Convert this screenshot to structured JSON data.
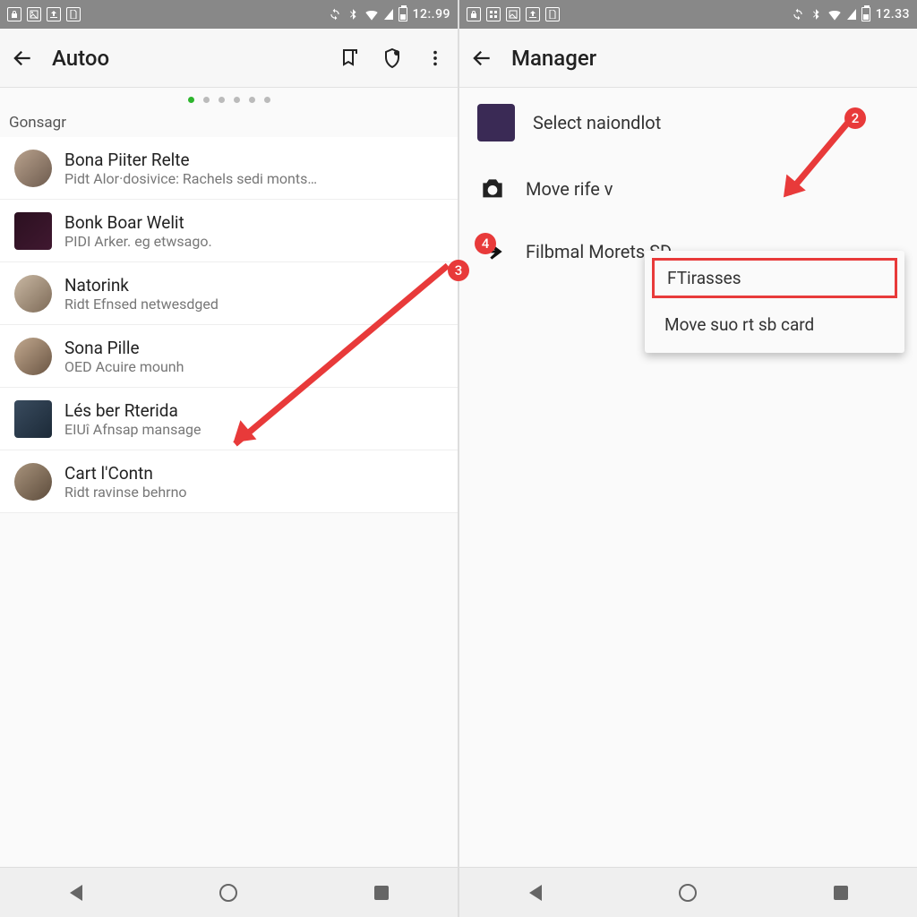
{
  "left": {
    "status_time": "12:.99",
    "title": "Autoo",
    "section": "Gonsagr",
    "items": [
      {
        "title": "Bona Piiter Relte",
        "sub": "Pidt Alor·dosivice: Rachels sedi monts…"
      },
      {
        "title": "Bonk Boar Welit",
        "sub": "PIDI Arker. eg etwsago."
      },
      {
        "title": "Natorink",
        "sub": "Ridt Efnsed netwesdged"
      },
      {
        "title": "Sona Pille",
        "sub": "OED Acuire mounh"
      },
      {
        "title": "Lés ber Rterida",
        "sub": "EIUî Afnsap mansage"
      },
      {
        "title": "Cart l'Contn",
        "sub": "Ridt ravinse behrno"
      }
    ]
  },
  "right": {
    "status_time": "12.33",
    "title": "Manager",
    "items": [
      {
        "label": "Select naiondlot"
      },
      {
        "label": "Move rife v"
      },
      {
        "label": "Filbmal Morets SD"
      }
    ],
    "popup": {
      "opt1": "FTirasses",
      "opt2": "Move suo rt sb card"
    }
  },
  "annotations": {
    "badge2": "2",
    "badge3": "3",
    "badge4": "4"
  }
}
